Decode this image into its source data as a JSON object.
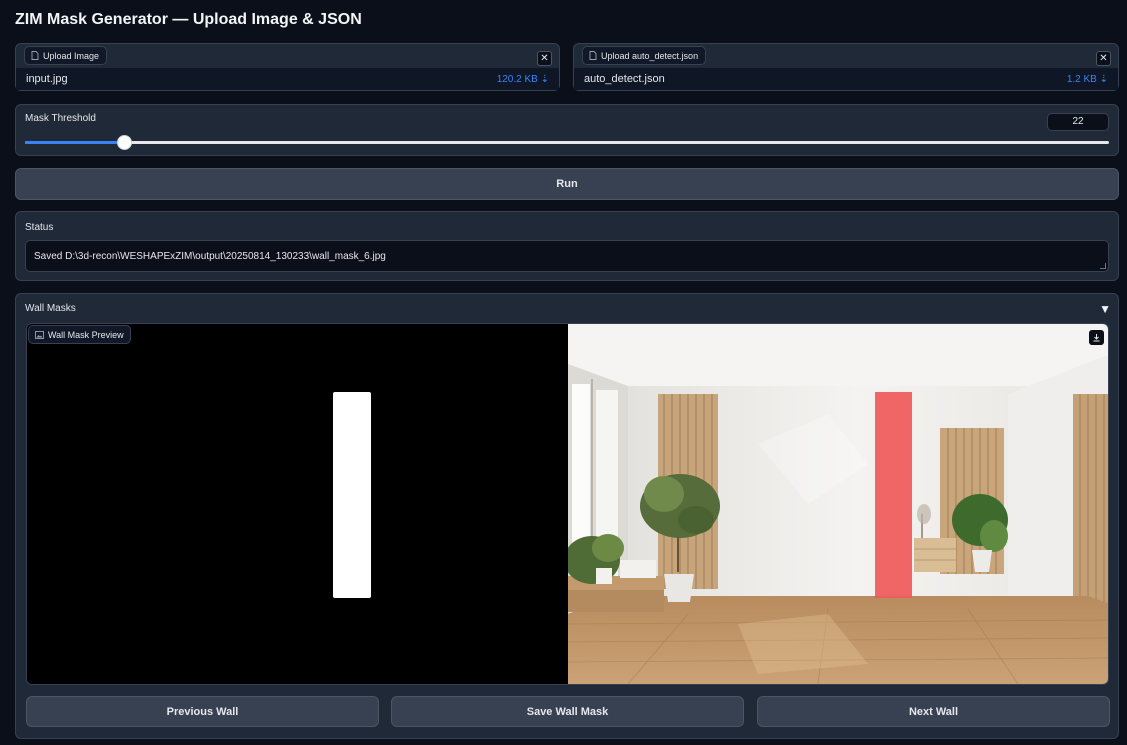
{
  "page_title": "ZIM Mask Generator — Upload Image & JSON",
  "image_upload": {
    "label": "Upload Image",
    "file_name": "input.jpg",
    "file_size": "120.2 KB ⇣",
    "close": "✕"
  },
  "json_upload": {
    "label": "Upload auto_detect.json",
    "file_name": "auto_detect.json",
    "file_size": "1.2 KB ⇣",
    "close": "✕"
  },
  "threshold": {
    "label": "Mask Threshold",
    "value": "22",
    "slider_fraction": 0.091
  },
  "run_button": "Run",
  "status": {
    "label": "Status",
    "text": "Saved D:\\3d-recon\\WESHAPExZIM\\output\\20250814_130233\\wall_mask_6.jpg"
  },
  "wall_masks": {
    "label": "Wall Masks",
    "toggle": "▼",
    "preview_label": "Wall Mask Preview"
  },
  "buttons": {
    "previous": "Previous Wall",
    "save": "Save Wall Mask",
    "next": "Next Wall"
  },
  "colors": {
    "accent": "#3b82f6",
    "mask_overlay": "#f05a5a",
    "background": "#0b0f19"
  },
  "icons": [
    "file-icon",
    "close-icon",
    "image-icon",
    "download-icon",
    "chevron-down-icon",
    "resize-icon"
  ]
}
